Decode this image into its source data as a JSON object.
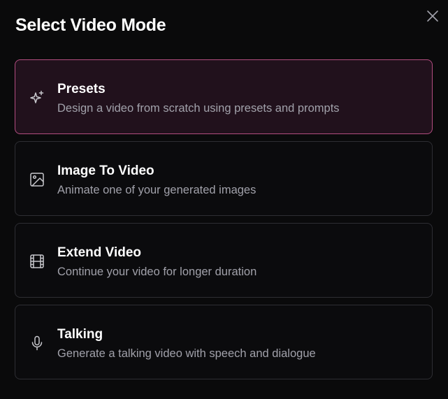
{
  "dialog": {
    "title": "Select Video Mode",
    "close_icon": "close-icon"
  },
  "options": [
    {
      "label": "Presets",
      "description": "Design a video from scratch using presets and prompts",
      "icon": "sparkles-icon",
      "selected": true
    },
    {
      "label": "Image To Video",
      "description": "Animate one of your generated images",
      "icon": "image-icon",
      "selected": false
    },
    {
      "label": "Extend Video",
      "description": "Continue your video for longer duration",
      "icon": "film-icon",
      "selected": false
    },
    {
      "label": "Talking",
      "description": "Generate a talking video with speech and dialogue",
      "icon": "microphone-icon",
      "selected": false
    }
  ],
  "colors": {
    "background": "#0a0a0b",
    "selected_border": "#b24d80",
    "selected_background": "#21111c",
    "card_border": "#2e2e33",
    "muted_text": "#a1a1aa"
  }
}
